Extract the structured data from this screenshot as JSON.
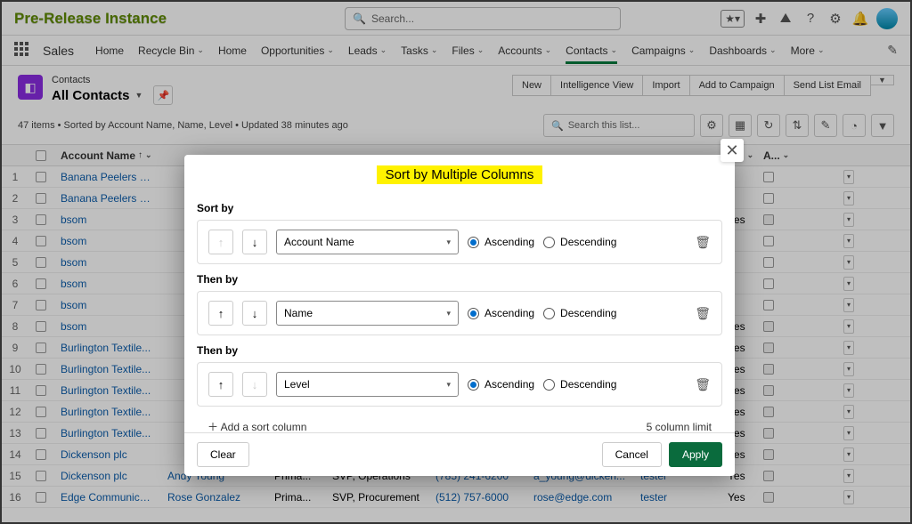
{
  "header": {
    "instance_label": "Pre-Release Instance",
    "search_placeholder": "Search..."
  },
  "nav": {
    "app_name": "Sales",
    "items": [
      "Home",
      "Recycle Bin",
      "Home",
      "Opportunities",
      "Leads",
      "Tasks",
      "Files",
      "Accounts",
      "Contacts",
      "Campaigns",
      "Dashboards",
      "More"
    ],
    "active_index": 8
  },
  "listview": {
    "object_label": "Contacts",
    "list_name": "All Contacts",
    "status": "47 items • Sorted by Account Name, Name, Level • Updated 38 minutes ago",
    "actions": [
      "New",
      "Intelligence View",
      "Import",
      "Add to Campaign",
      "Send List Email"
    ],
    "search_placeholder": "Search this list..."
  },
  "table": {
    "columns": {
      "account": "Account Name",
      "a1": "A...",
      "a2": "A..."
    },
    "rows": [
      {
        "n": "1",
        "acct": "Banana Peelers Inc",
        "name": "",
        "type": "",
        "title": "",
        "phone": "",
        "email": "",
        "owner": "",
        "a1": "",
        "chk": false,
        "a2": ""
      },
      {
        "n": "2",
        "acct": "Banana Peelers Inc",
        "name": "",
        "type": "",
        "title": "",
        "phone": "",
        "email": "",
        "owner": "",
        "a1": "",
        "chk": false,
        "a2": ""
      },
      {
        "n": "3",
        "acct": "bsom",
        "name": "",
        "type": "",
        "title": "",
        "phone": "",
        "email": "",
        "owner": "",
        "a1": "Yes",
        "chk": true,
        "a2": ""
      },
      {
        "n": "4",
        "acct": "bsom",
        "name": "",
        "type": "",
        "title": "",
        "phone": "",
        "email": "",
        "owner": "",
        "a1": "",
        "chk": false,
        "a2": ""
      },
      {
        "n": "5",
        "acct": "bsom",
        "name": "",
        "type": "",
        "title": "",
        "phone": "",
        "email": "",
        "owner": "",
        "a1": "",
        "chk": false,
        "a2": ""
      },
      {
        "n": "6",
        "acct": "bsom",
        "name": "",
        "type": "",
        "title": "",
        "phone": "",
        "email": "",
        "owner": "",
        "a1": "",
        "chk": false,
        "a2": ""
      },
      {
        "n": "7",
        "acct": "bsom",
        "name": "",
        "type": "",
        "title": "",
        "phone": "",
        "email": "",
        "owner": "",
        "a1": "",
        "chk": false,
        "a2": ""
      },
      {
        "n": "8",
        "acct": "bsom",
        "name": "",
        "type": "",
        "title": "",
        "phone": "",
        "email": "",
        "owner": "",
        "a1": "Yes",
        "chk": true,
        "a2": ""
      },
      {
        "n": "9",
        "acct": "Burlington Textile...",
        "name": "",
        "type": "",
        "title": "",
        "phone": "",
        "email": "",
        "owner": "",
        "a1": "Yes",
        "chk": true,
        "a2": ""
      },
      {
        "n": "10",
        "acct": "Burlington Textile...",
        "name": "",
        "type": "",
        "title": "",
        "phone": "",
        "email": "",
        "owner": "",
        "a1": "Yes",
        "chk": true,
        "a2": ""
      },
      {
        "n": "11",
        "acct": "Burlington Textile...",
        "name": "",
        "type": "",
        "title": "",
        "phone": "",
        "email": "",
        "owner": "",
        "a1": "Yes",
        "chk": true,
        "a2": ""
      },
      {
        "n": "12",
        "acct": "Burlington Textile...",
        "name": "",
        "type": "",
        "title": "",
        "phone": "",
        "email": "",
        "owner": "",
        "a1": "Yes",
        "chk": true,
        "a2": ""
      },
      {
        "n": "13",
        "acct": "Burlington Textile...",
        "name": "",
        "type": "",
        "title": "",
        "phone": "",
        "email": "",
        "owner": "",
        "a1": "Yes",
        "chk": true,
        "a2": ""
      },
      {
        "n": "14",
        "acct": "Dickenson plc",
        "name": "",
        "type": "",
        "title": "",
        "phone": "",
        "email": "",
        "owner": "",
        "a1": "Yes",
        "chk": true,
        "a2": ""
      },
      {
        "n": "15",
        "acct": "Dickenson plc",
        "name": "Andy Young",
        "type": "Prima...",
        "title": "SVP, Operations",
        "phone": "(785) 241-6200",
        "email": "a_young@dicken...",
        "owner": "tester",
        "a1": "Yes",
        "chk": true,
        "a2": ""
      },
      {
        "n": "16",
        "acct": "Edge Communica...",
        "name": "Rose Gonzalez",
        "type": "Prima...",
        "title": "SVP, Procurement",
        "phone": "(512) 757-6000",
        "email": "rose@edge.com",
        "owner": "tester",
        "a1": "Yes",
        "chk": true,
        "a2": ""
      }
    ]
  },
  "modal": {
    "title": "Sort by Multiple Columns",
    "sort_by_label": "Sort by",
    "then_by_label": "Then by",
    "ascending": "Ascending",
    "descending": "Descending",
    "rows": [
      {
        "field": "Account Name",
        "dir": "asc",
        "up_disabled": true,
        "down_disabled": false
      },
      {
        "field": "Name",
        "dir": "asc",
        "up_disabled": false,
        "down_disabled": false
      },
      {
        "field": "Level",
        "dir": "asc",
        "up_disabled": false,
        "down_disabled": true
      }
    ],
    "add_label": "Add a sort column",
    "limit_label": "5 column limit",
    "clear": "Clear",
    "cancel": "Cancel",
    "apply": "Apply"
  }
}
